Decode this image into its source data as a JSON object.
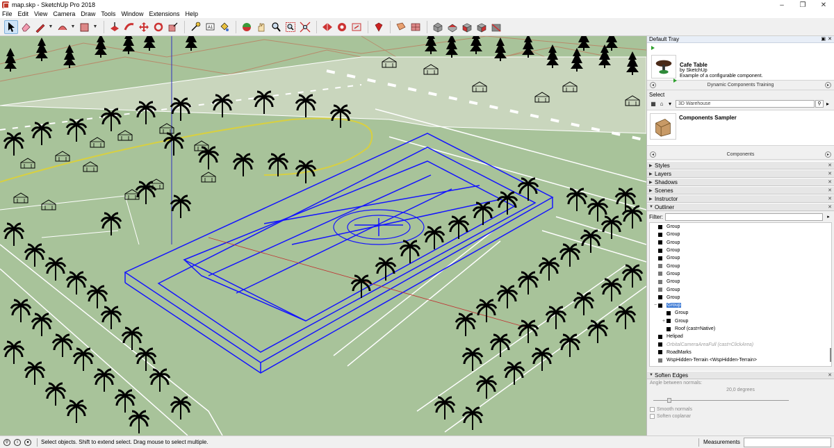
{
  "window": {
    "title": "map.skp - SketchUp Pro 2018",
    "controls": [
      "–",
      "❐",
      "✕"
    ]
  },
  "menu": [
    "File",
    "Edit",
    "View",
    "Camera",
    "Draw",
    "Tools",
    "Window",
    "Extensions",
    "Help"
  ],
  "toolbar": {
    "tools": [
      "select-tool",
      "eraser-tool",
      "line-tool",
      "arc-tool",
      "rectangle-tool",
      "push-pull-tool",
      "move-tool",
      "rotate-tool",
      "follow-me-tool",
      "scale-tool",
      "offset-tool",
      "tape-measure-tool",
      "text-tool",
      "paint-bucket-tool",
      "orbit-tool",
      "pan-tool",
      "zoom-tool",
      "zoom-window-tool",
      "zoom-extents-tool",
      "warehouse-tool",
      "extension-warehouse-tool",
      "layout-tool",
      "ruby-tool",
      "section-plane-tool",
      "section-display-tool",
      "iso-view-tool",
      "top-view-tool",
      "front-view-tool",
      "right-view-tool",
      "back-view-tool"
    ]
  },
  "tray": {
    "title": "Default Tray",
    "component": {
      "name": "Cafe Table",
      "author": "by SketchUp",
      "description": "Example of a configurable component."
    },
    "collection_nav": "Dynamic Components Training",
    "select_label": "Select",
    "search_placeholder": "3D Warehouse",
    "sampler_name": "Components Sampler",
    "components_nav": "Components",
    "panels": [
      "Styles",
      "Layers",
      "Shadows",
      "Scenes",
      "Instructor"
    ],
    "outliner_title": "Outliner",
    "filter_label": "Filter:",
    "outliner_items": [
      {
        "label": "Group",
        "indent": 1,
        "icon": "group",
        "exp": ""
      },
      {
        "label": "Group",
        "indent": 1,
        "icon": "group",
        "exp": ""
      },
      {
        "label": "Group",
        "indent": 1,
        "icon": "group",
        "exp": ""
      },
      {
        "label": "Group",
        "indent": 1,
        "icon": "group",
        "exp": ""
      },
      {
        "label": "Group",
        "indent": 1,
        "icon": "group",
        "exp": ""
      },
      {
        "label": "Group",
        "indent": 1,
        "icon": "comp",
        "exp": ""
      },
      {
        "label": "Group",
        "indent": 1,
        "icon": "comp",
        "exp": ""
      },
      {
        "label": "Group",
        "indent": 1,
        "icon": "comp",
        "exp": ""
      },
      {
        "label": "Group",
        "indent": 1,
        "icon": "comp",
        "exp": ""
      },
      {
        "label": "Group",
        "indent": 1,
        "icon": "group",
        "exp": ""
      },
      {
        "label": "Group",
        "indent": 1,
        "icon": "group",
        "exp": "−",
        "selected": true
      },
      {
        "label": "Group",
        "indent": 2,
        "icon": "group",
        "exp": ""
      },
      {
        "label": "Group",
        "indent": 2,
        "icon": "group",
        "exp": "+"
      },
      {
        "label": "Roof (cast=Native)",
        "indent": 2,
        "icon": "group",
        "exp": ""
      },
      {
        "label": "Helipad",
        "indent": 1,
        "icon": "group",
        "exp": ""
      },
      {
        "label": "OrbitalCameraAreaFull (cast=ClickArea)",
        "indent": 1,
        "icon": "group",
        "exp": "",
        "dim": true
      },
      {
        "label": "RoadMarks",
        "indent": 1,
        "icon": "group",
        "exp": ""
      },
      {
        "label": "WspHidden-Terrain <WspHidden-Terrain>",
        "indent": 1,
        "icon": "comp",
        "exp": ""
      }
    ],
    "soften": {
      "title": "Soften Edges",
      "angle_label": "Angle between normals:",
      "angle_value": "20,0  degrees",
      "angle_fraction": 0.11,
      "smooth_label": "Smooth normals",
      "coplanar_label": "Soften coplanar"
    }
  },
  "status": {
    "hint": "Select objects. Shift to extend select. Drag mouse to select multiple.",
    "measurements_label": "Measurements",
    "measurements_value": ""
  },
  "colors": {
    "ground": "#a8c39a",
    "selection": "#1414ff",
    "panel": "#f0f0f0"
  }
}
